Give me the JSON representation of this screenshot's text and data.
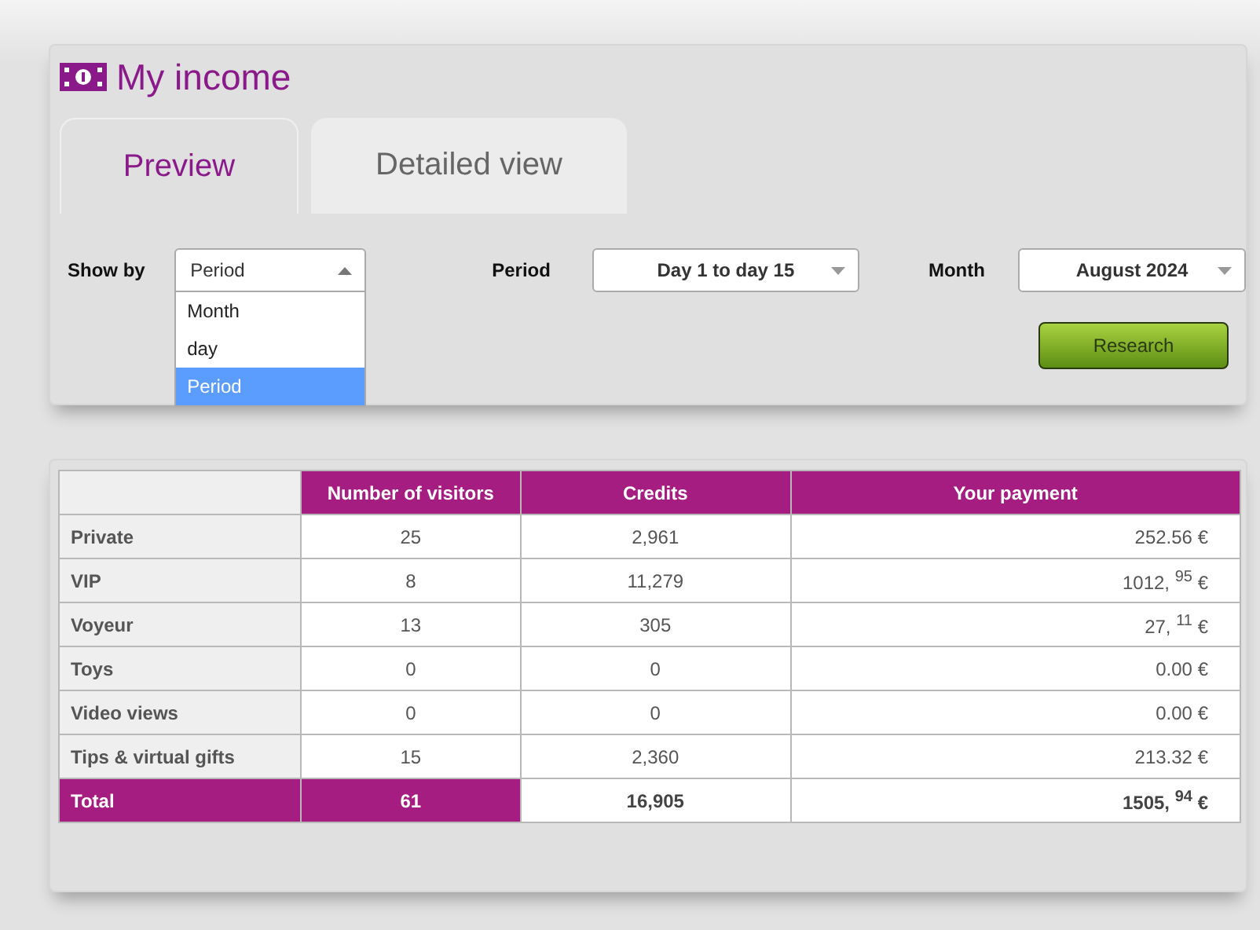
{
  "title": "My income",
  "tabs": [
    {
      "label": "Preview",
      "selected": true
    },
    {
      "label": "Detailed view",
      "selected": false
    }
  ],
  "filters": [
    {
      "label": "Show by",
      "value": "Period",
      "open": true,
      "options": [
        {
          "label": "Month",
          "selected": false
        },
        {
          "label": "day",
          "selected": false
        },
        {
          "label": "Period",
          "selected": true
        }
      ]
    },
    {
      "label": "Period",
      "value": "Day 1 to day 15",
      "open": false
    },
    {
      "label": "Month",
      "value": "August 2024",
      "open": false
    }
  ],
  "search_button": "Research",
  "table": {
    "columns": [
      "",
      "Number of visitors",
      "Credits",
      "Your payment"
    ],
    "rows": [
      {
        "kind": "data",
        "cells": [
          "Private",
          "25",
          "2,961",
          "252.56 €"
        ]
      },
      {
        "kind": "data",
        "cells": [
          "VIP",
          "8",
          "11,279",
          "1012, $^{95}$ €"
        ]
      },
      {
        "kind": "data",
        "cells": [
          "Voyeur",
          "13",
          "305",
          "27, $^{11}$ €"
        ]
      },
      {
        "kind": "data",
        "cells": [
          "Toys",
          "0",
          "0",
          "0.00 €"
        ]
      },
      {
        "kind": "data",
        "cells": [
          "Video views",
          "0",
          "0",
          "0.00 €"
        ]
      },
      {
        "kind": "data",
        "cells": [
          "Tips & virtual gifts",
          "15",
          "2,360",
          "213.32 €"
        ]
      },
      {
        "kind": "total",
        "cells": [
          "Total",
          "61",
          "16,905",
          "1505, $^{94}$ €"
        ]
      }
    ]
  }
}
